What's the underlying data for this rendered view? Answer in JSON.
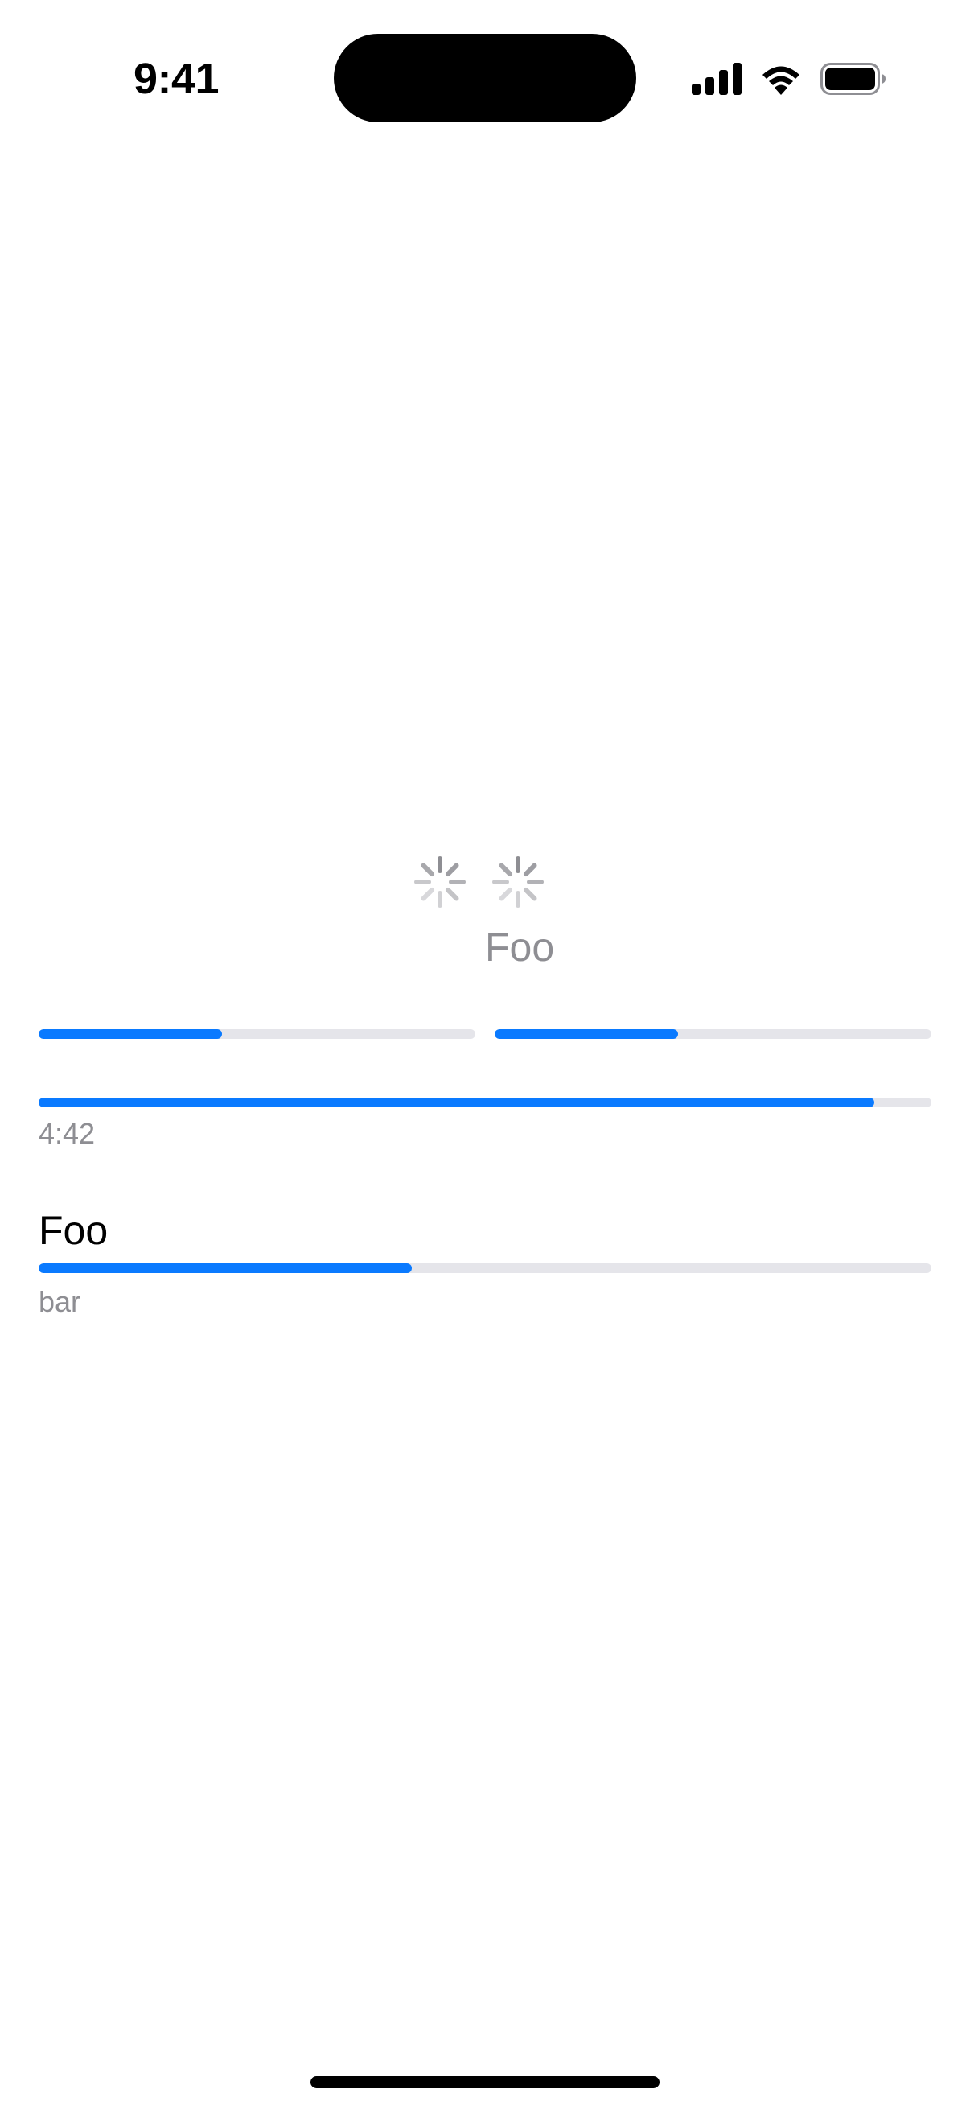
{
  "status_bar": {
    "time": "9:41",
    "icons": [
      "cellular-signal-icon",
      "wifi-icon",
      "battery-icon"
    ]
  },
  "spinners": [
    "activity-indicator-icon",
    "activity-indicator-icon"
  ],
  "center_label": "Foo",
  "progress": {
    "small_left": 0.42,
    "small_right": 0.42,
    "full": 0.936,
    "full_label": "4:42",
    "labeled_title": "Foo",
    "labeled": 0.418,
    "labeled_caption": "bar"
  },
  "colors": {
    "accent": "#0a7aff",
    "track": "#e5e5ea",
    "secondary_text": "#8e8e93"
  }
}
